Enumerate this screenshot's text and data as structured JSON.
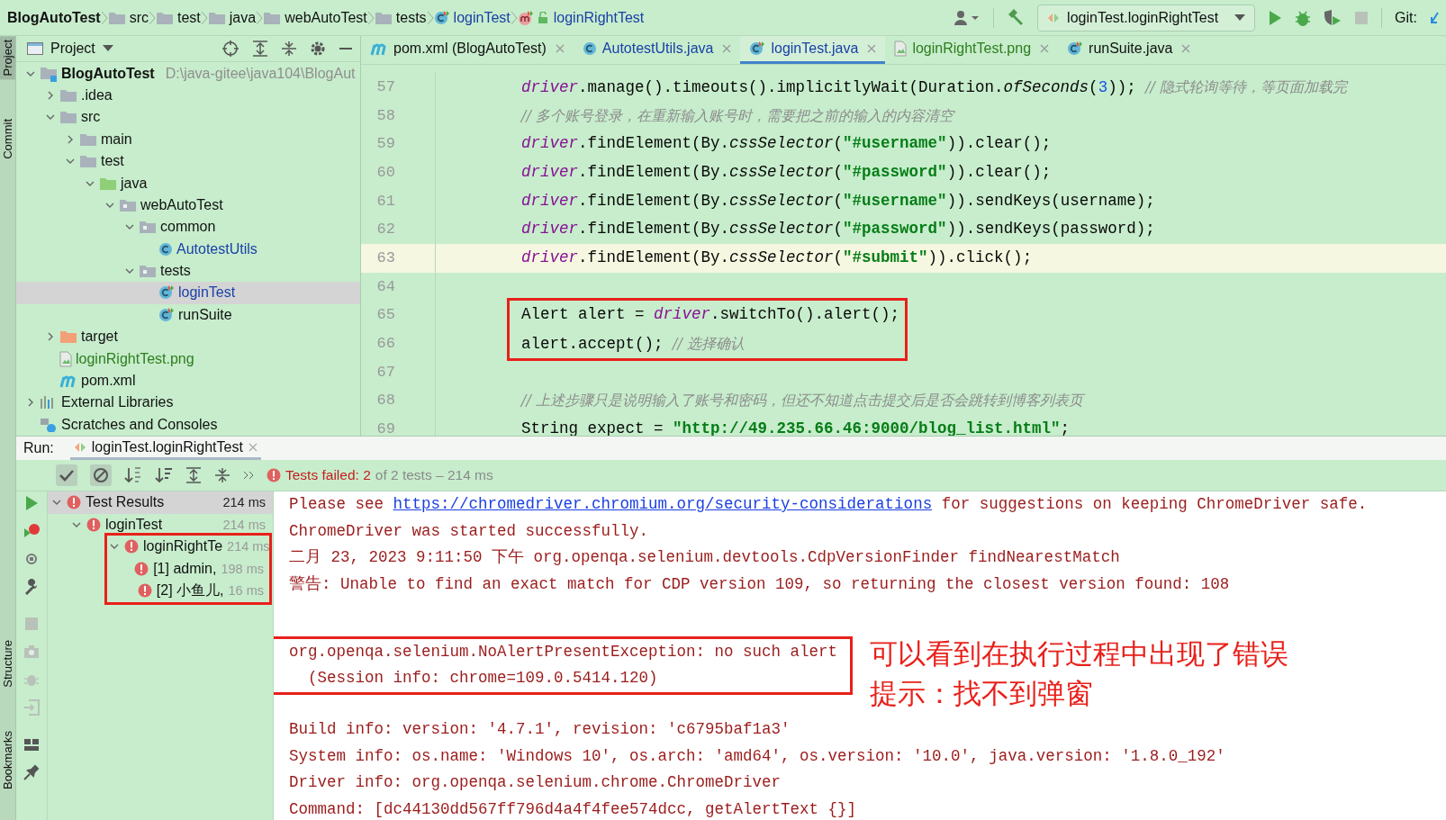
{
  "breadcrumb": [
    {
      "label": "BlogAutoTest",
      "kind": "project"
    },
    {
      "label": "src",
      "kind": "folder"
    },
    {
      "label": "test",
      "kind": "folder"
    },
    {
      "label": "java",
      "kind": "folder"
    },
    {
      "label": "webAutoTest",
      "kind": "folder"
    },
    {
      "label": "tests",
      "kind": "folder"
    },
    {
      "label": "loginTest",
      "kind": "test-class",
      "color": "#1a3fa8"
    },
    {
      "label": "loginRightTest",
      "kind": "method",
      "color": "#1a3fa8"
    }
  ],
  "toolbar": {
    "run_config": "loginTest.loginRightTest",
    "git_label": "Git:"
  },
  "side_labels": {
    "top": [
      {
        "label": "Project",
        "selected": true
      },
      {
        "label": "Commit",
        "selected": false
      }
    ],
    "bottom": [
      {
        "label": "Structure",
        "selected": false
      },
      {
        "label": "Bookmarks",
        "selected": false
      }
    ]
  },
  "project_panel": {
    "title": "Project",
    "tree": [
      {
        "label": "BlogAutoTest",
        "kind": "module",
        "hint": "D:\\java-gitee\\java104\\BlogAut",
        "expanded": true,
        "selected": false,
        "children": [
          {
            "label": ".idea",
            "kind": "folder",
            "expanded": false,
            "selected": false
          },
          {
            "label": "src",
            "kind": "folder",
            "expanded": true,
            "selected": false,
            "children": [
              {
                "label": "main",
                "kind": "folder",
                "expanded": false,
                "selected": false
              },
              {
                "label": "test",
                "kind": "folder",
                "expanded": true,
                "selected": false,
                "children": [
                  {
                    "label": "java",
                    "kind": "source",
                    "expanded": true,
                    "selected": false,
                    "children": [
                      {
                        "label": "webAutoTest",
                        "kind": "package",
                        "expanded": true,
                        "selected": false,
                        "children": [
                          {
                            "label": "common",
                            "kind": "package",
                            "expanded": true,
                            "selected": false,
                            "children": [
                              {
                                "label": "AutotestUtils",
                                "kind": "class",
                                "color": "#1a3fa8",
                                "selected": false
                              }
                            ]
                          },
                          {
                            "label": "tests",
                            "kind": "package",
                            "expanded": true,
                            "selected": false,
                            "children": [
                              {
                                "label": "loginTest",
                                "kind": "test-class",
                                "color": "#1a3fa8",
                                "selected": true
                              },
                              {
                                "label": "runSuite",
                                "kind": "test-class",
                                "selected": false
                              }
                            ]
                          }
                        ]
                      }
                    ]
                  }
                ]
              }
            ]
          },
          {
            "label": "target",
            "kind": "excluded",
            "expanded": false,
            "selected": false
          },
          {
            "label": "loginRightTest.png",
            "kind": "image",
            "color": "#2f7d1f",
            "selected": false
          },
          {
            "label": "pom.xml",
            "kind": "maven",
            "selected": false
          }
        ]
      },
      {
        "label": "External Libraries",
        "kind": "library",
        "expanded": false,
        "selected": false
      },
      {
        "label": "Scratches and Consoles",
        "kind": "scratches",
        "selected": false
      }
    ]
  },
  "editor": {
    "tabs": [
      {
        "label": "pom.xml (BlogAutoTest)",
        "kind": "maven",
        "selected": false
      },
      {
        "label": "AutotestUtils.java",
        "kind": "class",
        "color": "#1a3fa8",
        "selected": false
      },
      {
        "label": "loginTest.java",
        "kind": "test-class",
        "color": "#1a3fa8",
        "selected": true
      },
      {
        "label": "loginRightTest.png",
        "kind": "image",
        "color": "#2f7d1f",
        "selected": false
      },
      {
        "label": "runSuite.java",
        "kind": "test-class",
        "selected": false
      }
    ],
    "blocks": [
      {
        "framed": false,
        "lines": [
          {
            "number": "57",
            "current": false,
            "tokens": [
              {
                "text": "driver",
                "kind": "field"
              },
              {
                "text": ".manage().timeouts().implicitlyWait(Duration.",
                "kind": "plain"
              },
              {
                "text": "ofSeconds",
                "kind": "static"
              },
              {
                "text": "(",
                "kind": "plain"
              },
              {
                "text": "3",
                "kind": "number"
              },
              {
                "text": ")); ",
                "kind": "plain"
              },
              {
                "text": "// 隐式轮询等待，等页面加载完",
                "kind": "comment"
              }
            ]
          },
          {
            "number": "58",
            "current": false,
            "tokens": [
              {
                "text": "// 多个账号登录，在重新输入账号时，需要把之前的输入的内容清空",
                "kind": "comment"
              }
            ]
          },
          {
            "number": "59",
            "current": false,
            "tokens": [
              {
                "text": "driver",
                "kind": "field"
              },
              {
                "text": ".findElement(By.",
                "kind": "plain"
              },
              {
                "text": "cssSelector",
                "kind": "static"
              },
              {
                "text": "(",
                "kind": "plain"
              },
              {
                "text": "\"#username\"",
                "kind": "string"
              },
              {
                "text": ")).clear();",
                "kind": "plain"
              }
            ]
          },
          {
            "number": "60",
            "current": false,
            "tokens": [
              {
                "text": "driver",
                "kind": "field"
              },
              {
                "text": ".findElement(By.",
                "kind": "plain"
              },
              {
                "text": "cssSelector",
                "kind": "static"
              },
              {
                "text": "(",
                "kind": "plain"
              },
              {
                "text": "\"#password\"",
                "kind": "string"
              },
              {
                "text": ")).clear();",
                "kind": "plain"
              }
            ]
          },
          {
            "number": "61",
            "current": false,
            "tokens": [
              {
                "text": "driver",
                "kind": "field"
              },
              {
                "text": ".findElement(By.",
                "kind": "plain"
              },
              {
                "text": "cssSelector",
                "kind": "static"
              },
              {
                "text": "(",
                "kind": "plain"
              },
              {
                "text": "\"#username\"",
                "kind": "string"
              },
              {
                "text": ")).sendKeys(username);",
                "kind": "plain"
              }
            ]
          },
          {
            "number": "62",
            "current": false,
            "tokens": [
              {
                "text": "driver",
                "kind": "field"
              },
              {
                "text": ".findElement(By.",
                "kind": "plain"
              },
              {
                "text": "cssSelector",
                "kind": "static"
              },
              {
                "text": "(",
                "kind": "plain"
              },
              {
                "text": "\"#password\"",
                "kind": "string"
              },
              {
                "text": ")).sendKeys(password);",
                "kind": "plain"
              }
            ]
          },
          {
            "number": "63",
            "current": true,
            "tokens": [
              {
                "text": "driver",
                "kind": "field"
              },
              {
                "text": ".findElement(By.",
                "kind": "plain"
              },
              {
                "text": "cssSelector",
                "kind": "static"
              },
              {
                "text": "(",
                "kind": "plain"
              },
              {
                "text": "\"#submit\"",
                "kind": "string"
              },
              {
                "text": ")).click();",
                "kind": "plain"
              }
            ]
          },
          {
            "number": "64",
            "current": false
          }
        ]
      },
      {
        "framed": true,
        "lines": [
          {
            "number": "65",
            "current": false,
            "tokens": [
              {
                "text": "Alert alert = ",
                "kind": "plain"
              },
              {
                "text": "driver",
                "kind": "field"
              },
              {
                "text": ".switchTo().alert();",
                "kind": "plain"
              }
            ]
          },
          {
            "number": "66",
            "current": false,
            "tokens": [
              {
                "text": "alert.accept(); ",
                "kind": "plain"
              },
              {
                "text": "// 选择确认",
                "kind": "comment"
              }
            ]
          }
        ]
      },
      {
        "framed": false,
        "lines": [
          {
            "number": "67",
            "current": false
          },
          {
            "number": "68",
            "current": false,
            "tokens": [
              {
                "text": "// 上述步骤只是说明输入了账号和密码，但还不知道点击提交后是否会跳转到博客列表页",
                "kind": "comment"
              }
            ]
          },
          {
            "number": "69",
            "current": false,
            "tokens": [
              {
                "text": "String expect = ",
                "kind": "plain"
              },
              {
                "text": "\"http://49.235.66.46:9000/blog_list.html\"",
                "kind": "string"
              },
              {
                "text": ";",
                "kind": "plain"
              }
            ]
          }
        ]
      }
    ]
  },
  "run_panel": {
    "label": "Run:",
    "tab": "loginTest.loginRightTest",
    "status": {
      "failed": "Tests failed: 2",
      "detail": "of 2 tests – 214 ms"
    },
    "tests": [
      {
        "label": "Test Results",
        "time": "214 ms",
        "failed": true,
        "selected": true,
        "expanded": true,
        "framed": false,
        "children": [
          {
            "label": "loginTest",
            "time": "214 ms",
            "failed": true,
            "selected": false,
            "expanded": true,
            "framed": false,
            "children": [
              {
                "label": "loginRightTe",
                "time": "214 ms",
                "failed": true,
                "selected": false,
                "expanded": true,
                "framed": true,
                "children": [
                  {
                    "label": "[1] admin,",
                    "time": "198 ms",
                    "failed": true,
                    "selected": false,
                    "framed": false
                  },
                  {
                    "label": "[2] 小鱼儿,",
                    "time": "16 ms",
                    "failed": true,
                    "selected": false,
                    "framed": false
                  }
                ]
              }
            ]
          }
        ]
      }
    ],
    "console": [
      {
        "framed": false,
        "lines": [
          [
            {
              "text": "Please see ",
              "kind": "text"
            },
            {
              "text": "https://chromedriver.chromium.org/security-considerations",
              "kind": "link"
            },
            {
              "text": " for suggestions on keeping ChromeDriver safe.",
              "kind": "text"
            }
          ],
          [
            {
              "text": "ChromeDriver was started successfully.",
              "kind": "text"
            }
          ],
          [
            {
              "text": "二月 23, 2023 9:11:50 下午 org.openqa.selenium.devtools.CdpVersionFinder findNearestMatch",
              "kind": "text"
            }
          ],
          [
            {
              "text": "警告: Unable to find an exact match for CDP version 109, so returning the closest version found: 108",
              "kind": "text"
            }
          ]
        ]
      },
      {
        "framed": true,
        "note": [
          "可以看到在执行过程中出现了错误",
          "提示：找不到弹窗"
        ],
        "lines": [
          [
            {
              "text": "org.openqa.selenium.NoAlertPresentException: no such alert",
              "kind": "text"
            }
          ],
          [
            {
              "text": "  (Session info: chrome=109.0.5414.120)",
              "kind": "text"
            }
          ]
        ]
      },
      {
        "framed": false,
        "lines": [
          [
            {
              "text": "Build info: version: '4.7.1', revision: 'c6795baf1a3'",
              "kind": "text"
            }
          ],
          [
            {
              "text": "System info: os.name: 'Windows 10', os.arch: 'amd64', os.version: '10.0', java.version: '1.8.0_192'",
              "kind": "text"
            }
          ],
          [
            {
              "text": "Driver info: org.openqa.selenium.chrome.ChromeDriver",
              "kind": "text"
            }
          ],
          [
            {
              "text": "Command: [dc44130dd567ff796d4a4f4fee574dcc, getAlertText {}]",
              "kind": "text"
            }
          ]
        ]
      }
    ]
  }
}
